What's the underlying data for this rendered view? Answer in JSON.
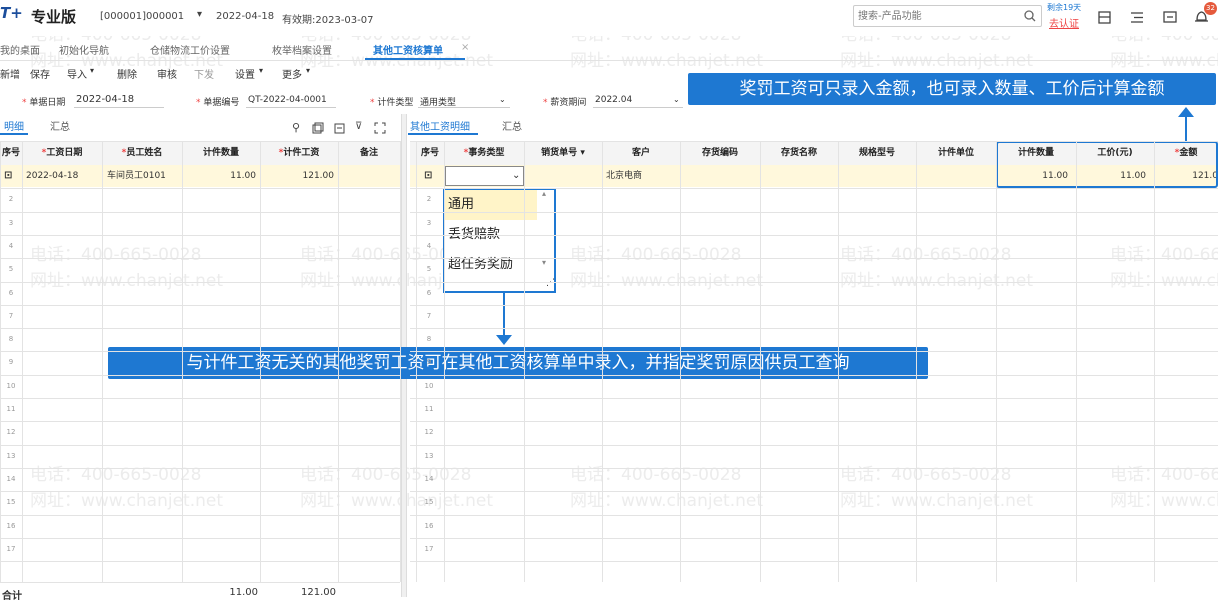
{
  "topbar": {
    "logo_glyph": "T+",
    "product_name": "专业版",
    "account": "[000001]000001",
    "date": "2022-04-18",
    "validity": "有效期:2023-03-07",
    "search_placeholder": "搜索-产品功能",
    "remaining_days": "剩余19天",
    "certify_link": "去认证",
    "notification_count": "32"
  },
  "tabs": [
    {
      "label": "我的桌面"
    },
    {
      "label": "初始化导航"
    },
    {
      "label": "仓储物流工价设置"
    },
    {
      "label": "枚举档案设置"
    },
    {
      "label": "其他工资核算单",
      "active": true,
      "close": "×"
    }
  ],
  "toolbar": [
    "新增",
    "保存",
    "导入",
    "删除",
    "审核",
    "下发",
    "设置",
    "更多"
  ],
  "form": {
    "date_label": "单据日期",
    "date_value": "2022-04-18",
    "code_label": "单据编号",
    "code_value": "QT-2022-04-0001",
    "type_label": "计件类型",
    "type_value": "通用类型",
    "period_label": "薪资期间",
    "period_value": "2022.04"
  },
  "left_panel": {
    "tabs": [
      "明细",
      "汇总"
    ],
    "headers": [
      "序号",
      "工资日期",
      "员工姓名",
      "计件数量",
      "计件工资",
      "备注"
    ],
    "row1": {
      "date": "2022-04-18",
      "employee": "车间员工0101",
      "qty": "11.00",
      "wage": "121.00"
    },
    "total_label": "合计",
    "total_qty": "11.00",
    "total_wage": "121.00"
  },
  "right_panel": {
    "tabs": [
      "其他工资明细",
      "汇总"
    ],
    "headers": [
      "序号",
      "事务类型",
      "销货单号",
      "客户",
      "存货编码",
      "存货名称",
      "规格型号",
      "计件单位",
      "计件数量",
      "工价(元)",
      "金额"
    ],
    "row1": {
      "customer": "北京电商",
      "qty": "11.00",
      "price": "11.00",
      "amount": "121.0"
    },
    "dropdown_options": [
      "通用",
      "丢货赔款",
      "超任务奖励"
    ]
  },
  "row_numbers": [
    "1",
    "2",
    "3",
    "4",
    "5",
    "6",
    "7",
    "8",
    "9",
    "10",
    "11",
    "12",
    "13",
    "14",
    "15",
    "16",
    "17"
  ],
  "callouts": {
    "top_right": "奖罚工资可只录入金额，也可录入数量、工价后计算金额",
    "middle": "与计件工资无关的其他奖罚工资可在其他工资核算单中录入，并指定奖罚原因供员工查询"
  },
  "watermark": {
    "phone": "电话：400-665-0028",
    "site": "网址：www.chanjet.net"
  },
  "colors": {
    "accent": "#1e78d2",
    "highlight_row": "#fff8dc",
    "badge": "#e55a3c"
  }
}
